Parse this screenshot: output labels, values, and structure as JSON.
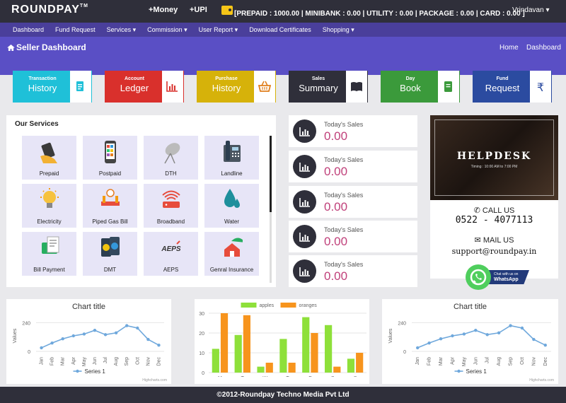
{
  "topbar": {
    "logo": "ROUNDPAY",
    "logo_tm": "TM",
    "money_label": "+Money",
    "upi_label": "+UPI",
    "balances": "[PREPAID : 1000.00 | MINIBANK : 0.00 | UTILITY : 0.00 | PACKAGE : 0.00 | CARD : 0.00 ]",
    "user": "Vrindavan"
  },
  "nav": {
    "items": [
      "Dashboard",
      "Fund Request",
      "Services ▾",
      "Commission ▾",
      "User Report ▾",
      "Download Certificates",
      "Shopping ▾"
    ]
  },
  "header": {
    "title": "Seller Dashboard",
    "breadcrumb_home": "Home",
    "breadcrumb_current": "Dashboard"
  },
  "quick_tiles": [
    {
      "small": "Transaction",
      "big": "History",
      "color": "#1fc0d8",
      "icon": "document-icon",
      "icon_color": "#1fc0d8"
    },
    {
      "small": "Account",
      "big": "Ledger",
      "color": "#d9302c",
      "icon": "bar-chart-icon",
      "icon_color": "#d9302c"
    },
    {
      "small": "Purchase",
      "big": "History",
      "color": "#d6b20a",
      "icon": "basket-icon",
      "icon_color": "#e07f1d"
    },
    {
      "small": "Sales",
      "big": "Summary",
      "color": "#2f2f3a",
      "icon": "book-icon",
      "icon_color": "#2f2f3a"
    },
    {
      "small": "Day",
      "big": "Book",
      "color": "#3b9a3b",
      "icon": "notebook-icon",
      "icon_color": "#3b9a3b"
    },
    {
      "small": "Fund",
      "big": "Request",
      "color": "#2b4ba0",
      "icon": "rupee-icon",
      "icon_color": "#2b4ba0"
    }
  ],
  "services": {
    "title": "Our Services",
    "items": [
      "Prepaid",
      "Postpaid",
      "DTH",
      "Landline",
      "Electricity",
      "Piped Gas Bill",
      "Broadband",
      "Water",
      "Bill Payment",
      "DMT",
      "AEPS",
      "Genral Insurance"
    ]
  },
  "sales_cards": [
    {
      "label": "Today's Sales",
      "value": "0.00"
    },
    {
      "label": "Today's Sales",
      "value": "0.00"
    },
    {
      "label": "Today's Sales",
      "value": "0.00"
    },
    {
      "label": "Today's Sales",
      "value": "0.00"
    },
    {
      "label": "Today's Sales",
      "value": "0.00"
    }
  ],
  "helpdesk": {
    "title": "HELPDESK",
    "timing": "Timing : 10:00 AM to 7:00 PM",
    "call_label": "CALL US",
    "phone": "0522 - 4077113",
    "mail_label": "MAIL US",
    "email": "support@roundpay.in",
    "whatsapp_small": "Chat with us on",
    "whatsapp_big": "WhatsApp"
  },
  "footer": "©2012-Roundpay Techno Media Pvt Ltd",
  "chart_data": [
    {
      "type": "line",
      "title": "Chart title",
      "ylabel": "Values",
      "categories": [
        "Jan",
        "Feb",
        "Mar",
        "Apr",
        "May",
        "Jun",
        "Jul",
        "Aug",
        "Sep",
        "Oct",
        "Nov",
        "Dec"
      ],
      "series": [
        {
          "name": "Series 1",
          "values": [
            30,
            70,
            105,
            130,
            145,
            176,
            140,
            155,
            215,
            195,
            100,
            52
          ],
          "color": "#6fa8dc"
        }
      ],
      "yticks": [
        0,
        240
      ],
      "ylim": [
        0,
        260
      ],
      "credit": "Highcharts.com"
    },
    {
      "type": "bar",
      "categories": [
        "M",
        "T",
        "W",
        "T",
        "F",
        "S",
        "S"
      ],
      "series": [
        {
          "name": "apples",
          "values": [
            12,
            19,
            3,
            17,
            28,
            24,
            7
          ],
          "color": "#8ee03a"
        },
        {
          "name": "oranges",
          "values": [
            30,
            29,
            5,
            5,
            20,
            3,
            10
          ],
          "color": "#f7941d"
        }
      ],
      "yticks": [
        0,
        10,
        20,
        30
      ],
      "ylim": [
        0,
        30
      ]
    },
    {
      "type": "line",
      "title": "Chart title",
      "ylabel": "Values",
      "categories": [
        "Jan",
        "Feb",
        "Mar",
        "Apr",
        "May",
        "Jun",
        "Jul",
        "Aug",
        "Sep",
        "Oct",
        "Nov",
        "Dec"
      ],
      "series": [
        {
          "name": "Series 1",
          "values": [
            30,
            70,
            105,
            130,
            145,
            176,
            140,
            155,
            215,
            195,
            100,
            52
          ],
          "color": "#6fa8dc"
        }
      ],
      "yticks": [
        0,
        240
      ],
      "ylim": [
        0,
        260
      ],
      "credit": "Highcharts.com"
    }
  ]
}
